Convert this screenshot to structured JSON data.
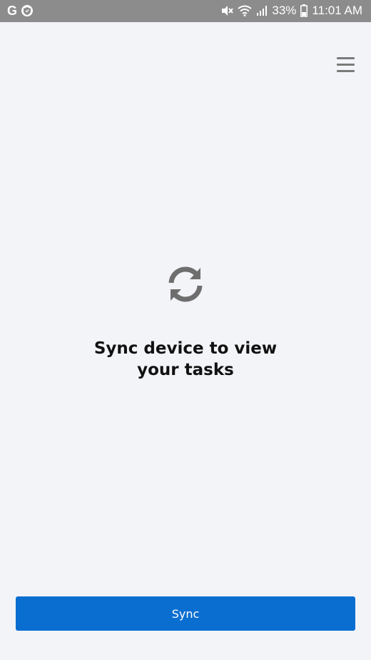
{
  "status_bar": {
    "battery_percent": "33%",
    "time": "11:01 AM",
    "left_icons": [
      "google-icon",
      "shield-icon"
    ],
    "right_icons": [
      "mute-icon",
      "wifi-icon",
      "signal-icon",
      "battery-icon"
    ]
  },
  "header": {
    "menu_icon": "hamburger-menu-icon"
  },
  "empty_state": {
    "icon": "sync-icon",
    "message_line1": "Sync device to view",
    "message_line2": "your tasks"
  },
  "footer": {
    "sync_label": "Sync"
  },
  "colors": {
    "status_bar": "#8c8c8c",
    "background": "#f3f4f8",
    "accent": "#0a6ed1",
    "icon_gray": "#7a7a7a"
  }
}
